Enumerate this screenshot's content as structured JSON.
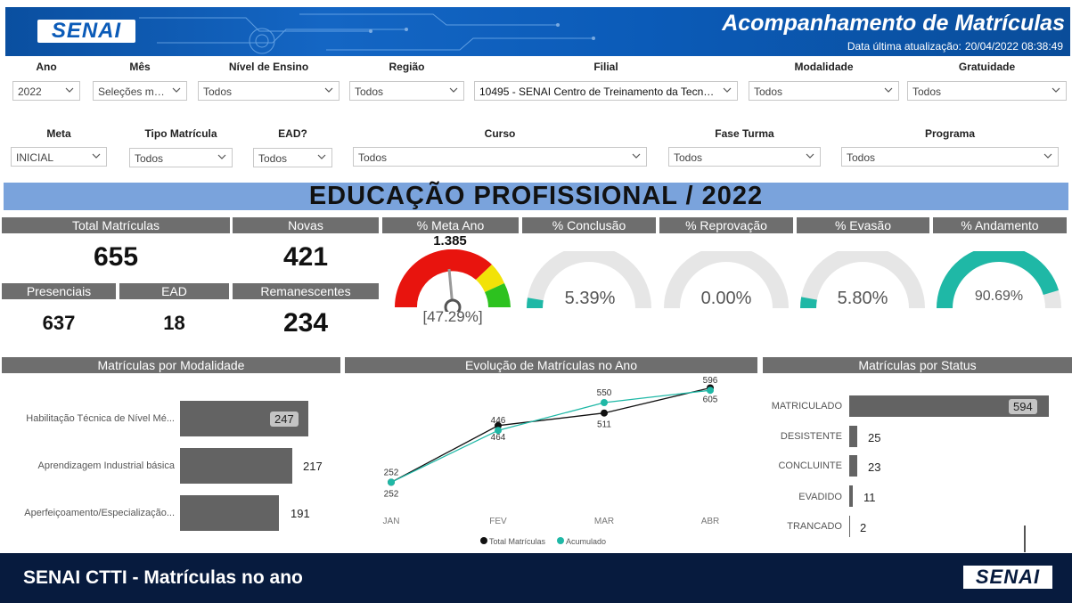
{
  "header": {
    "logo": "SENAI",
    "title": "Acompanhamento de Matrículas",
    "update_label": "Data última atualização:",
    "update_value": "20/04/2022 08:38:49"
  },
  "filters_row1": [
    {
      "label": "Ano",
      "value": "2022"
    },
    {
      "label": "Mês",
      "value": "Seleções múl..."
    },
    {
      "label": "Nível de Ensino",
      "value": "Todos"
    },
    {
      "label": "Região",
      "value": "Todos"
    },
    {
      "label": "Filial",
      "value": "10495 - SENAI Centro de Treinamento da Tecno..."
    },
    {
      "label": "Modalidade",
      "value": "Todos"
    },
    {
      "label": "Gratuidade",
      "value": "Todos"
    }
  ],
  "filters_row2": [
    {
      "label": "Meta",
      "value": "INICIAL"
    },
    {
      "label": "Tipo Matrícula",
      "value": "Todos"
    },
    {
      "label": "EAD?",
      "value": "Todos"
    },
    {
      "label": "Curso",
      "value": "Todos"
    },
    {
      "label": "Fase Turma",
      "value": "Todos"
    },
    {
      "label": "Programa",
      "value": "Todos"
    }
  ],
  "banner": "EDUCAÇÃO PROFISSIONAL / 2022",
  "kpis": {
    "total": {
      "label": "Total Matrículas",
      "value": "655"
    },
    "novas": {
      "label": "Novas",
      "value": "421"
    },
    "presenciais": {
      "label": "Presenciais",
      "value": "637"
    },
    "ead": {
      "label": "EAD",
      "value": "18"
    },
    "remanescentes": {
      "label": "Remanescentes",
      "value": "234"
    }
  },
  "gauges": [
    {
      "label": "% Meta Ano",
      "target": "1.385",
      "value_text": "[47.29%]",
      "fraction": 0.4729
    },
    {
      "label": "% Conclusão",
      "value_text": "5.39%",
      "fraction": 0.0539,
      "color": "#1fb8a6"
    },
    {
      "label": "% Reprovação",
      "value_text": "0.00%",
      "fraction": 0.0,
      "color": "#1fb8a6"
    },
    {
      "label": "% Evasão",
      "value_text": "5.80%",
      "fraction": 0.058,
      "color": "#1fb8a6"
    },
    {
      "label": "% Andamento",
      "value_text": "90.69%",
      "fraction": 0.9069,
      "color": "#1fb8a6"
    }
  ],
  "modalidade": {
    "title": "Matrículas por Modalidade",
    "items": [
      {
        "label": "Habilitação Técnica de Nível Mé...",
        "value": 247
      },
      {
        "label": "Aprendizagem Industrial básica",
        "value": 217
      },
      {
        "label": "Aperfeiçoamento/Especialização...",
        "value": 191
      }
    ]
  },
  "evolucao": {
    "title": "Evolução de Matrículas no Ano",
    "legend": [
      "Total Matrículas",
      "Acumulado"
    ]
  },
  "chart_data": {
    "type": "line",
    "categories": [
      "JAN",
      "FEV",
      "MAR",
      "ABR"
    ],
    "series": [
      {
        "name": "Total Matrículas",
        "values": [
          252,
          464,
          511,
          605
        ],
        "color": "#111111"
      },
      {
        "name": "Acumulado",
        "values": [
          252,
          446,
          550,
          596
        ],
        "color": "#1fb8a6"
      }
    ],
    "ylim": [
      200,
      650
    ]
  },
  "status": {
    "title": "Matrículas por Status",
    "items": [
      {
        "label": "MATRICULADO",
        "value": 594
      },
      {
        "label": "DESISTENTE",
        "value": 25
      },
      {
        "label": "CONCLUINTE",
        "value": 23
      },
      {
        "label": "EVADIDO",
        "value": 11
      },
      {
        "label": "TRANCADO",
        "value": 2
      }
    ]
  },
  "footer": {
    "title": "SENAI CTTI  - Matrículas no ano",
    "logo": "SENAI"
  }
}
